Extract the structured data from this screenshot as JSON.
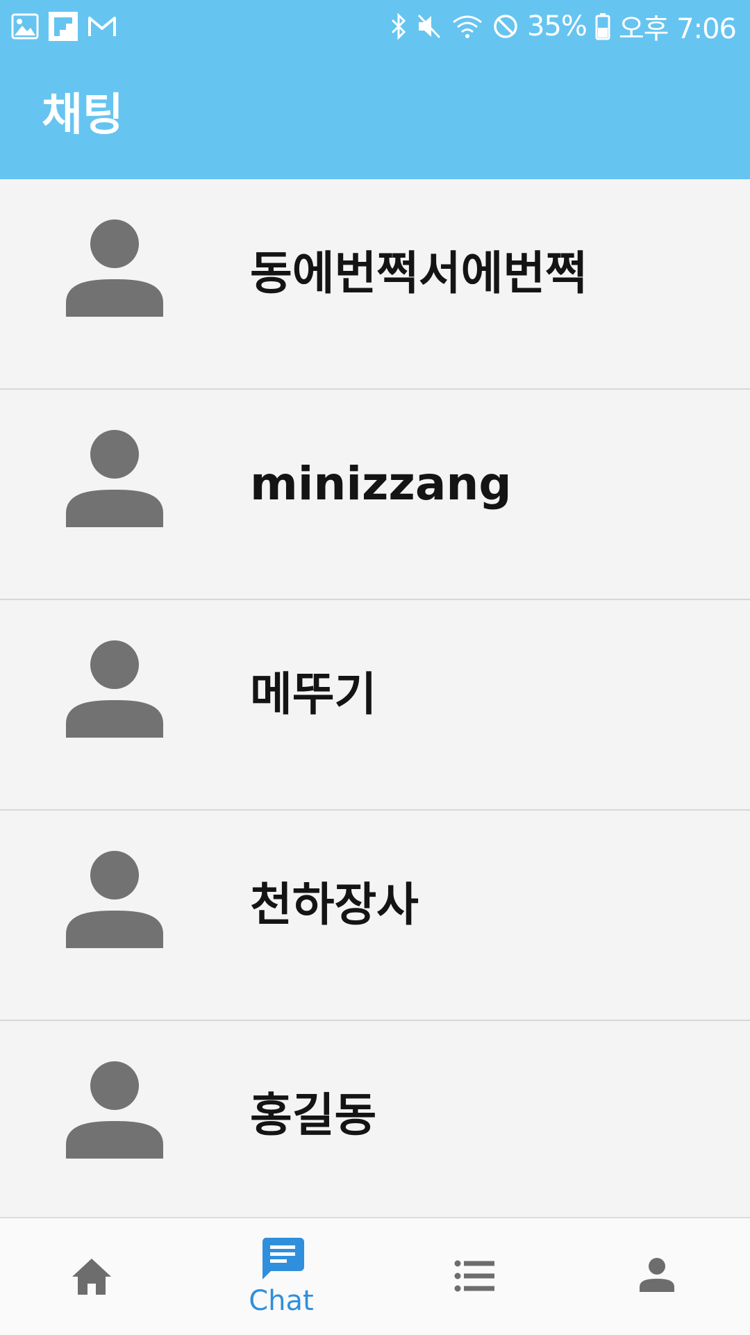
{
  "status_bar": {
    "left_icons": [
      "gallery-icon",
      "flipboard-icon",
      "gmail-icon"
    ],
    "right_icons": [
      "bluetooth-icon",
      "mute-icon",
      "wifi-icon",
      "do-not-disturb-icon",
      "battery-icon"
    ],
    "battery": "35%",
    "time": "오후 7:06"
  },
  "header": {
    "title": "채팅"
  },
  "chats": [
    {
      "name": "동에번쩍서에번쩍",
      "avatar": "person-icon"
    },
    {
      "name": "minizzang",
      "avatar": "person-icon"
    },
    {
      "name": "메뚜기",
      "avatar": "person-icon"
    },
    {
      "name": "천하장사",
      "avatar": "person-icon"
    },
    {
      "name": "홍길동",
      "avatar": "person-icon"
    }
  ],
  "bottom_nav": {
    "items": [
      {
        "id": "home",
        "icon": "home-icon",
        "label": "",
        "active": false
      },
      {
        "id": "chat",
        "icon": "chat-icon",
        "label": "Chat",
        "active": true
      },
      {
        "id": "list",
        "icon": "list-icon",
        "label": "",
        "active": false
      },
      {
        "id": "profile",
        "icon": "person-icon",
        "label": "",
        "active": false
      }
    ]
  },
  "colors": {
    "app_bar": "#66c4f0",
    "background": "#f4f4f4",
    "avatar": "#727272",
    "nav_active": "#2f8fdd",
    "nav_inactive": "#6d6d6d",
    "name_text": "#141414"
  }
}
